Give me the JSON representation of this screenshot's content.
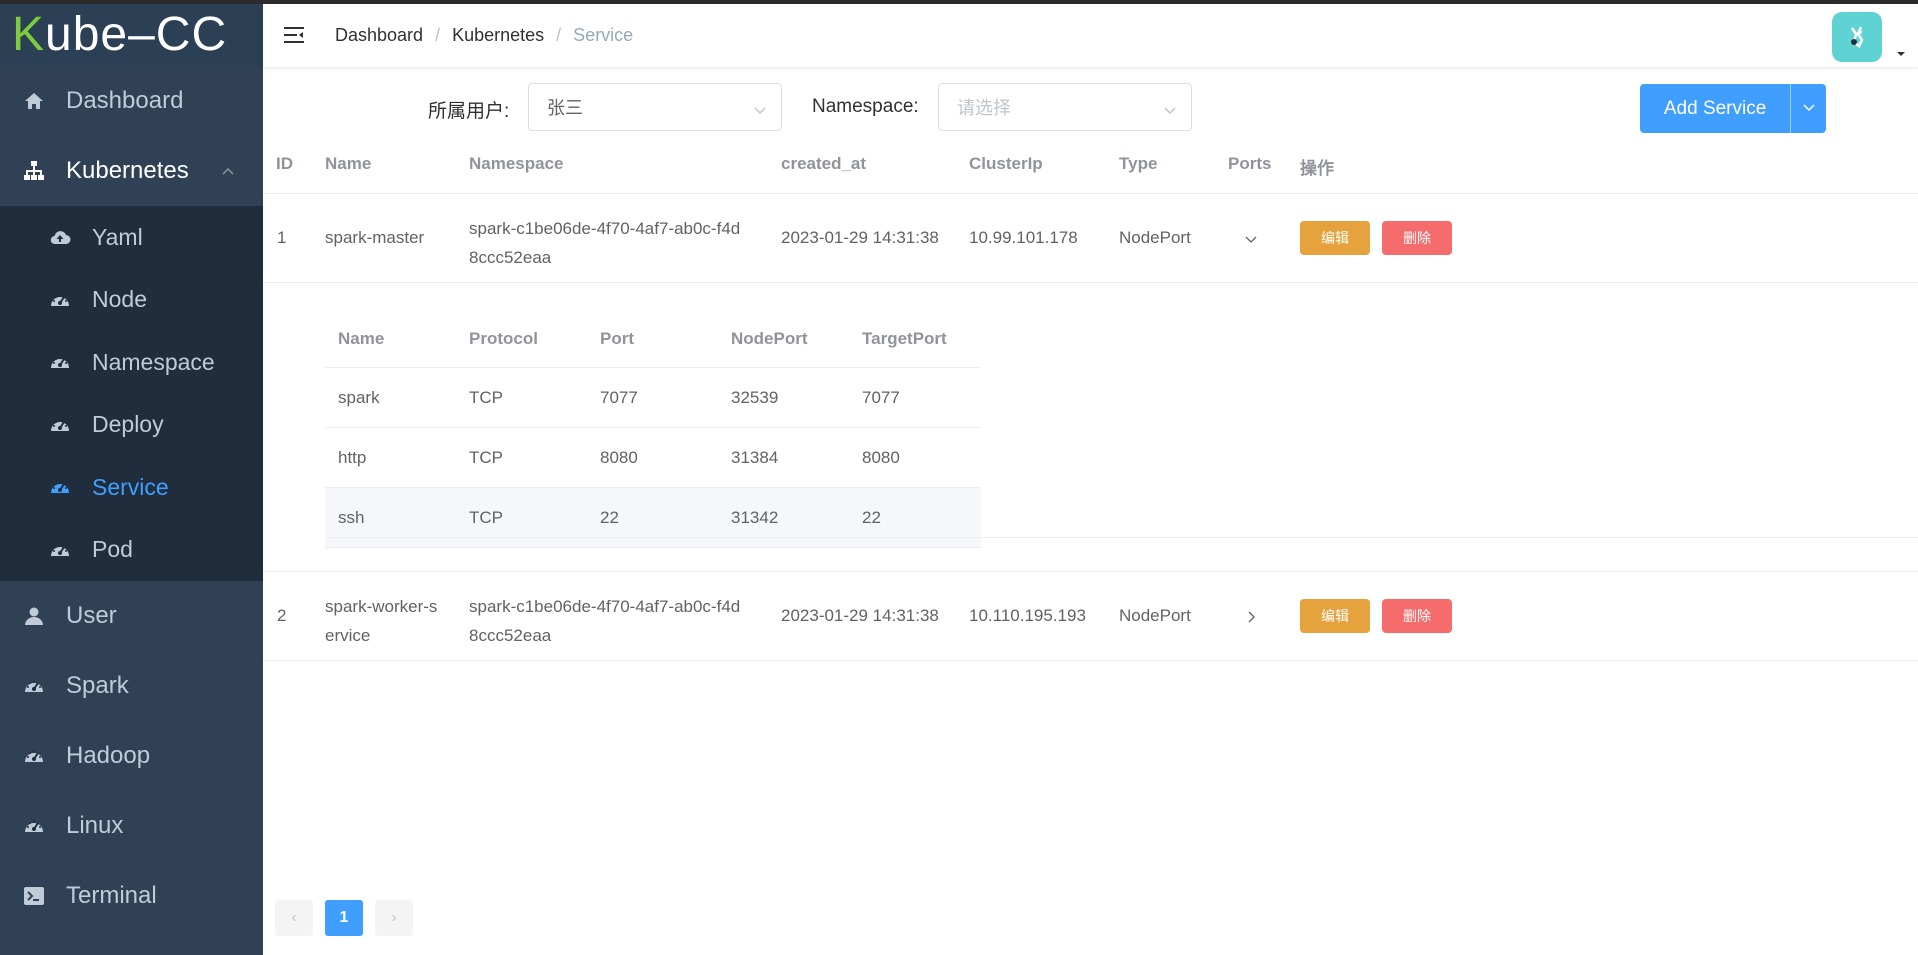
{
  "logo": {
    "text_k": "K",
    "text_rest": "ube–CC"
  },
  "sidebar": {
    "items": [
      {
        "label": "Dashboard",
        "icon": "home-icon"
      },
      {
        "label": "Kubernetes",
        "icon": "sitemap-icon",
        "open": true,
        "children": [
          {
            "label": "Yaml",
            "icon": "cloud-upload-icon"
          },
          {
            "label": "Node",
            "icon": "dashboard-gauge-icon"
          },
          {
            "label": "Namespace",
            "icon": "dashboard-gauge-icon"
          },
          {
            "label": "Deploy",
            "icon": "dashboard-gauge-icon"
          },
          {
            "label": "Service",
            "icon": "dashboard-gauge-icon",
            "active": true
          },
          {
            "label": "Pod",
            "icon": "dashboard-gauge-icon"
          }
        ]
      },
      {
        "label": "User",
        "icon": "user-icon"
      },
      {
        "label": "Spark",
        "icon": "dashboard-gauge-icon"
      },
      {
        "label": "Hadoop",
        "icon": "dashboard-gauge-icon"
      },
      {
        "label": "Linux",
        "icon": "dashboard-gauge-icon"
      },
      {
        "label": "Terminal",
        "icon": "terminal-icon"
      }
    ]
  },
  "breadcrumb": {
    "items": [
      "Dashboard",
      "Kubernetes",
      "Service"
    ],
    "separator": "/"
  },
  "filters": {
    "user_label": "所属用户:",
    "user_value": "张三",
    "namespace_label": "Namespace:",
    "namespace_placeholder": "请选择",
    "add_button": "Add Service"
  },
  "table": {
    "columns": [
      "ID",
      "Name",
      "Namespace",
      "created_at",
      "ClusterIp",
      "Type",
      "Ports",
      "操作"
    ],
    "rows": [
      {
        "id": "1",
        "name": "spark-master",
        "name_l1": "spark-master",
        "name_l2": "",
        "ns_l1": "spark-c1be06de-4f70-4af7-ab0c-f4d",
        "ns_l2": "8ccc52eaa",
        "created_at": "2023-01-29 14:31:38",
        "cluster_ip": "10.99.101.178",
        "type": "NodePort",
        "expanded": true
      },
      {
        "id": "2",
        "name_l1": "spark-worker-s",
        "name_l2": "ervice",
        "ns_l1": "spark-c1be06de-4f70-4af7-ab0c-f4d",
        "ns_l2": "8ccc52eaa",
        "created_at": "2023-01-29 14:31:38",
        "cluster_ip": "10.110.195.193",
        "type": "NodePort",
        "expanded": false
      }
    ],
    "edit_label": "编辑",
    "delete_label": "删除"
  },
  "ports_table": {
    "columns": [
      "Name",
      "Protocol",
      "Port",
      "NodePort",
      "TargetPort"
    ],
    "rows": [
      {
        "name": "spark",
        "protocol": "TCP",
        "port": "7077",
        "node_port": "32539",
        "target_port": "7077"
      },
      {
        "name": "http",
        "protocol": "TCP",
        "port": "8080",
        "node_port": "31384",
        "target_port": "8080"
      },
      {
        "name": "ssh",
        "protocol": "TCP",
        "port": "22",
        "node_port": "31342",
        "target_port": "22"
      }
    ]
  },
  "pagination": {
    "current": "1",
    "prev": "‹",
    "next": "›"
  },
  "colors": {
    "sidebar_bg": "#304156",
    "submenu_bg": "#1f2d3d",
    "accent": "#409eff",
    "edit": "#e6a23c",
    "delete": "#f56c6c",
    "logo_k": "#7ecb3f"
  }
}
